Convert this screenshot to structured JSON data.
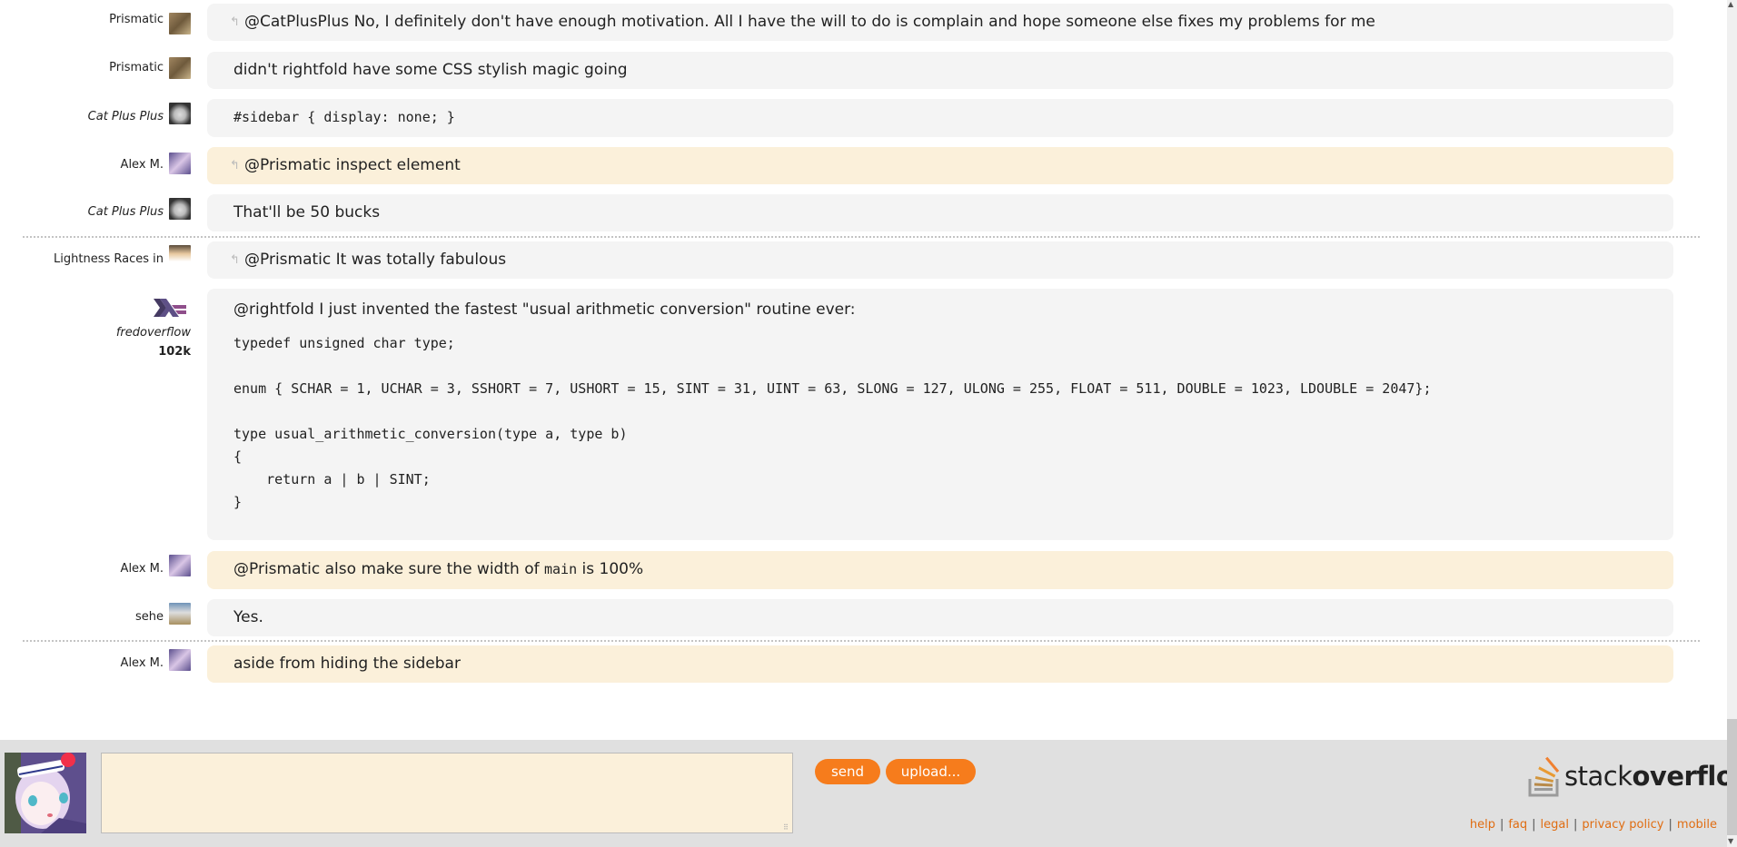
{
  "messages": [
    {
      "user": "Prismatic",
      "italic": false,
      "avatar": "prismatic-avatar",
      "mine": false,
      "reply": true,
      "text": "@CatPlusPlus No, I definitely don't have enough motivation. All I have the will to do is complain and hope someone else fixes my problems for me"
    },
    {
      "user": "Prismatic",
      "italic": false,
      "avatar": "prismatic-avatar",
      "mine": false,
      "reply": false,
      "text": "didn't rightfold have some CSS stylish magic going"
    },
    {
      "user": "Cat Plus Plus",
      "italic": true,
      "avatar": "catplusplus-avatar",
      "mine": false,
      "reply": false,
      "code": true,
      "text": "#sidebar { display: none; }"
    },
    {
      "user": "Alex M.",
      "italic": false,
      "avatar": "alexm-avatar",
      "mine": true,
      "reply": true,
      "text": "@Prismatic inspect element"
    },
    {
      "user": "Cat Plus Plus",
      "italic": true,
      "avatar": "catplusplus-avatar",
      "mine": false,
      "reply": false,
      "text": "That'll be 50 bucks"
    },
    {
      "user": "Lightness Races in",
      "italic": false,
      "avatar": "lightness-avatar",
      "mine": false,
      "reply": true,
      "text": "@Prismatic It was totally fabulous"
    },
    {
      "user": "Alex M.",
      "italic": false,
      "avatar": "alexm-avatar",
      "mine": true,
      "reply": false,
      "text_before": "@Prismatic also make sure the width of ",
      "text_code": "main",
      "text_after": " is 100%"
    },
    {
      "user": "sehe",
      "italic": false,
      "avatar": "sehe-avatar",
      "mine": false,
      "reply": false,
      "text": "Yes."
    },
    {
      "user": "Alex M.",
      "italic": false,
      "avatar": "alexm-avatar",
      "mine": true,
      "reply": false,
      "text": "aside from hiding the sidebar"
    }
  ],
  "code_message": {
    "user": "fredoverflow",
    "reputation": "102k",
    "head": "@rightfold I just invented the fastest \"usual arithmetic conversion\" routine ever:",
    "code": "typedef unsigned char type;\n\nenum { SCHAR = 1, UCHAR = 3, SSHORT = 7, USHORT = 15, SINT = 31, UINT = 63, SLONG = 127, ULONG = 255, FLOAT = 511, DOUBLE = 1023, LDOUBLE = 2047};\n\ntype usual_arithmetic_conversion(type a, type b)\n{\n    return a | b | SINT;\n}"
  },
  "footer": {
    "input_value": "",
    "send_label": "send",
    "upload_label": "upload...",
    "logo_light": "stack",
    "logo_bold": "overflow",
    "links": [
      "help",
      "faq",
      "legal",
      "privacy policy",
      "mobile"
    ]
  },
  "colors": {
    "accent": "#f67c1c",
    "link": "#e06d12",
    "own_message_bg": "#fbf0da",
    "message_bg": "#f4f4f4",
    "footer_bg": "#e0e0e0"
  }
}
